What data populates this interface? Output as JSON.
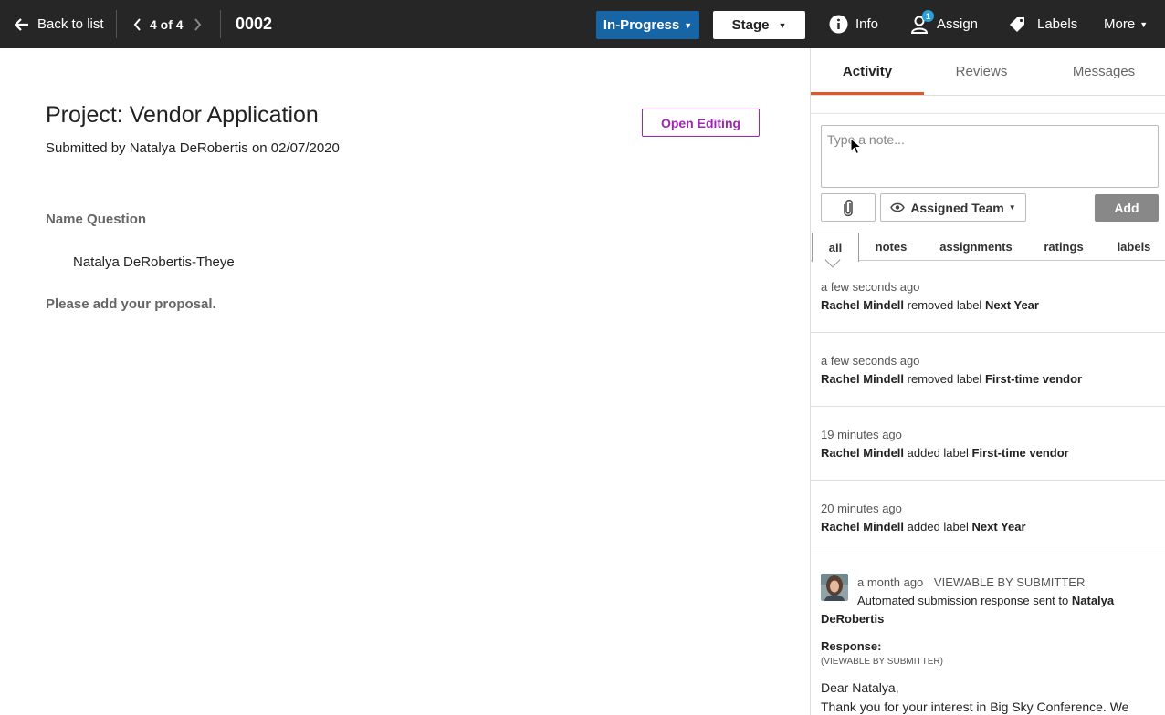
{
  "topbar": {
    "back_label": "Back to list",
    "pager": "4 of 4",
    "record_id": "0002",
    "status_label": "In-Progress",
    "stage_label": "Stage",
    "info_label": "Info",
    "assign_label": "Assign",
    "assign_badge": "1",
    "labels_label": "Labels",
    "more_label": "More"
  },
  "main": {
    "title": "Project: Vendor Application",
    "submitted": "Submitted by Natalya DeRobertis on 02/07/2020",
    "open_editing": "Open Editing",
    "questions": [
      {
        "label": "Name Question",
        "answer": "Natalya DeRobertis-Theye"
      },
      {
        "label": "Please add your proposal."
      }
    ]
  },
  "panel": {
    "tabs": [
      "Activity",
      "Reviews",
      "Messages"
    ],
    "note_placeholder": "Type a note...",
    "team_label": "Assigned Team",
    "add_label": "Add",
    "filters": [
      "all",
      "notes",
      "assignments",
      "ratings",
      "labels"
    ],
    "entries": [
      {
        "time": "a few seconds ago",
        "user": "Rachel Mindell",
        "action": "removed label",
        "target": "Next Year"
      },
      {
        "time": "a few seconds ago",
        "user": "Rachel Mindell",
        "action": "removed label",
        "target": "First-time vendor"
      },
      {
        "time": "19 minutes ago",
        "user": "Rachel Mindell",
        "action": "added label",
        "target": "First-time vendor"
      },
      {
        "time": "20 minutes ago",
        "user": "Rachel Mindell",
        "action": "added label",
        "target": "Next Year"
      }
    ],
    "message": {
      "time": "a month ago",
      "visibility": "VIEWABLE BY SUBMITTER",
      "text": "Automated submission response sent to",
      "recipient_first": "Natalya",
      "recipient_rest": "DeRobertis",
      "response_label": "Response:",
      "response_visibility": "(VIEWABLE BY SUBMITTER)",
      "greeting": "Dear Natalya,",
      "body": "Thank you for your interest in Big Sky Conference. We"
    }
  },
  "colors": {
    "topbar_bg": "#262626",
    "status_blue": "#1565a7",
    "accent_purple": "#9c27b0",
    "tab_accent": "#e0582a",
    "badge_blue": "#2aa0d8"
  }
}
